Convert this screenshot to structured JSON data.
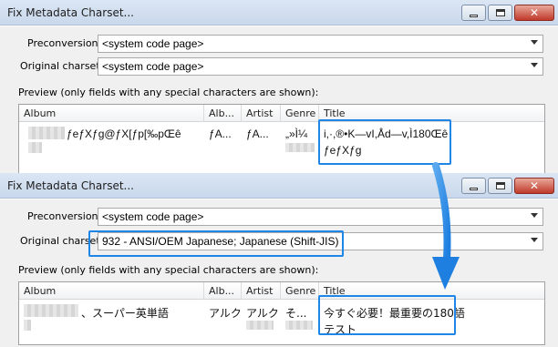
{
  "top_window": {
    "title": "Fix Metadata Charset...",
    "preconversion_label": "Preconversion:",
    "preconversion_value": "<system code page>",
    "original_charset_label": "Original charset:",
    "original_charset_value": "<system code page>",
    "preview_label": "Preview (only fields with any special characters are shown):",
    "columns": [
      "Album",
      "Alb...",
      "Artist",
      "Genre",
      "Title"
    ],
    "row": {
      "album": "ƒeƒXƒg@ƒX[ƒp[‰pŒê",
      "album_artist": "ƒA...",
      "artist": "ƒA...",
      "genre": "„»Ì¼",
      "title_line1": "i,·,®•K—vI,Åd—v,Ì180Œê",
      "title_line2": "ƒeƒXƒg"
    }
  },
  "bottom_window": {
    "title": "Fix Metadata Charset...",
    "preconversion_label": "Preconversion:",
    "preconversion_value": "<system code page>",
    "original_charset_label": "Original charset:",
    "original_charset_value": "932 - ANSI/OEM Japanese; Japanese (Shift-JIS)",
    "preview_label": "Preview (only fields with any special characters are shown):",
    "columns": [
      "Album",
      "Alb...",
      "Artist",
      "Genre",
      "Title"
    ],
    "row": {
      "album": "、スーパー英単語",
      "album_artist": "アルク",
      "artist": "アルク",
      "genre": "そ...",
      "title_line1": "今すぐ必要！最重要の180語",
      "title_line2": "テスト"
    }
  },
  "colors": {
    "highlight": "#1e86e6",
    "titlebar": "#c9d8ec",
    "dialog_bg": "#f0f0f0"
  },
  "icons": [
    "minimize-icon",
    "maximize-icon",
    "close-icon",
    "dropdown-arrow-icon",
    "arrow-down-icon"
  ]
}
